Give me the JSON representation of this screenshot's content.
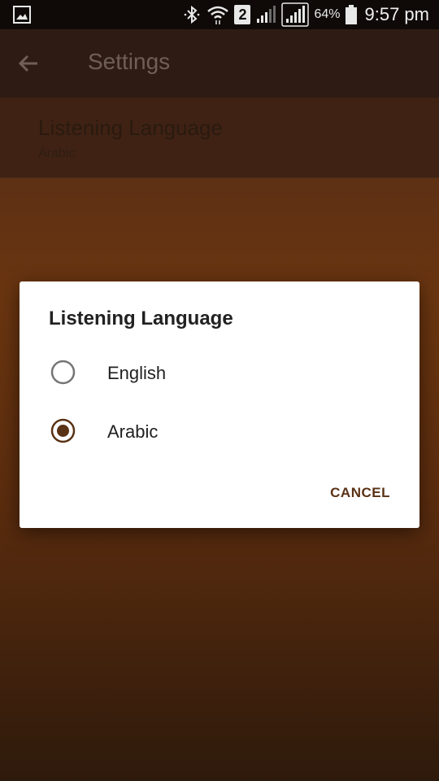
{
  "status_bar": {
    "battery_percent": "64%",
    "time": "9:57 pm",
    "sim_slot": "2",
    "icons": [
      "gallery-icon",
      "bluetooth-icon",
      "wifi-icon",
      "sim-2-icon",
      "signal-icon",
      "signal-icon",
      "battery-icon"
    ]
  },
  "app_bar": {
    "title": "Settings",
    "back_icon": "back-arrow-icon"
  },
  "settings_list": [
    {
      "title": "Listening Language",
      "subtitle": "Arabic"
    }
  ],
  "dialog": {
    "title": "Listening Language",
    "options": [
      {
        "label": "English",
        "selected": false
      },
      {
        "label": "Arabic",
        "selected": true
      }
    ],
    "cancel_label": "CANCEL"
  },
  "colors": {
    "accent": "#5a3215",
    "radio_unselected": "#757575"
  }
}
